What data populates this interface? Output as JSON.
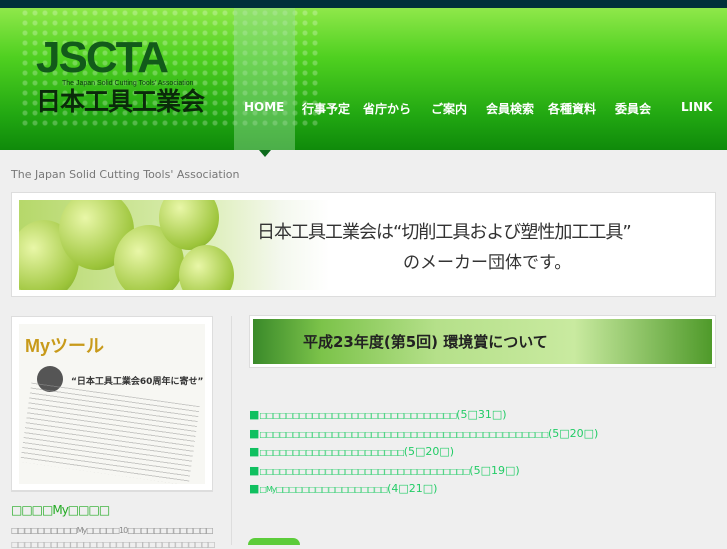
{
  "header": {
    "logo": {
      "abbr": "JSCTA",
      "english": "The Japan Solid Cutting Tools' Association",
      "japanese": "日本工具工業会"
    },
    "nav": [
      {
        "label": "HOME",
        "active": true
      },
      {
        "label": "行事予定"
      },
      {
        "label": "省庁から"
      },
      {
        "label": "ご案内"
      },
      {
        "label": "会員検索"
      },
      {
        "label": "各種資料"
      },
      {
        "label": "委員会"
      },
      {
        "label": "LINK"
      }
    ]
  },
  "tagline": "The Japan Solid Cutting Tools' Association",
  "banner": {
    "line1": "日本工具工業会は“切削工具および塑性加工工具”",
    "line2": "のメーカー団体です。"
  },
  "left": {
    "magazine": {
      "title": "Myツール",
      "headline": "“日本工具工業会60周年に寄せ”"
    },
    "heading": "□□□□My□□□□",
    "text": "□□□□□□□□□□My□□□□□10□□□□□□□□□□□□□",
    "text2": "□□□□□□□□□□□□□□□□□□□□□□□□□□□□□□□"
  },
  "right_banner": {
    "title": "平成23年度(第5回) 環境賞について"
  },
  "news": [
    {
      "text": "□□□□□□□□□□□□□□□□□□□□□□□□□□□□□□",
      "date": "(5□31□)"
    },
    {
      "text": "□□□□□□□□□□□□□□□□□□□□□□□□□□□□□□□□□□□□□□□□□□□□",
      "date": "(5□20□)"
    },
    {
      "text": "□□□□□□□□□□□□□□□□□□□□□□",
      "date": "(5□20□)"
    },
    {
      "text": "□□□□□□□□□□□□□□□□□□□□□□□□□□□□□□□□",
      "date": "(5□19□)"
    },
    {
      "text": "□My□□□□□□□□□□□□□□□□□",
      "date": "(4□21□)"
    }
  ],
  "colors": {
    "topbar": "#00313a",
    "accent": "#22cc66",
    "nav_dark": "#0d6a1d"
  }
}
